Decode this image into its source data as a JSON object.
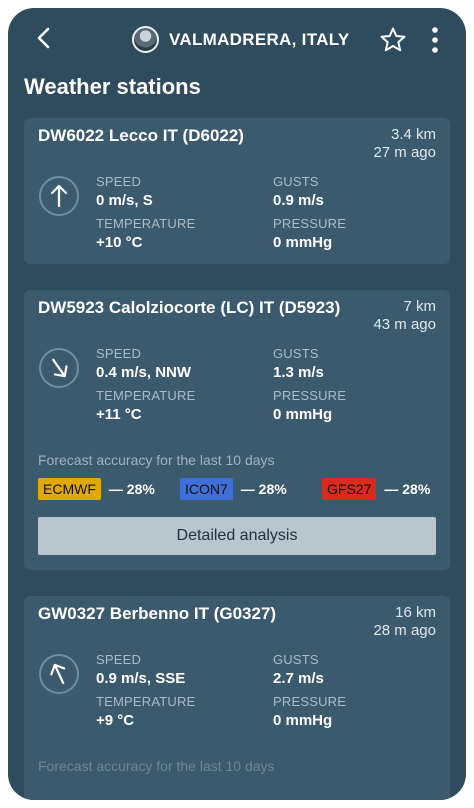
{
  "header": {
    "location": "VALMADRERA, ITALY"
  },
  "page_title": "Weather stations",
  "labels": {
    "speed": "SPEED",
    "gusts": "GUSTS",
    "temperature": "TEMPERATURE",
    "pressure": "PRESSURE",
    "accuracy": "Forecast accuracy for the last 10 days",
    "analysis": "Detailed analysis"
  },
  "stations": [
    {
      "name": "DW6022 Lecco IT (D6022)",
      "distance": "3.4 km",
      "ago": "27 m ago",
      "speed": "0 m/s, S",
      "gusts": "0.9 m/s",
      "temperature": "+10 °C",
      "pressure": "0 mmHg"
    },
    {
      "name": "DW5923 Calolziocorte (LC) IT (D5923)",
      "distance": "7 km",
      "ago": "43 m ago",
      "speed": "0.4 m/s, NNW",
      "gusts": "1.3 m/s",
      "temperature": "+11 °C",
      "pressure": "0 mmHg",
      "models": [
        {
          "name": "ECMWF",
          "pct": "— 28%",
          "color": "#e0a800"
        },
        {
          "name": "ICON7",
          "pct": "— 28%",
          "color": "#3f6fd8"
        },
        {
          "name": "GFS27",
          "pct": "— 28%",
          "color": "#d92a1e"
        }
      ]
    },
    {
      "name": "GW0327 Berbenno IT (G0327)",
      "distance": "16 km",
      "ago": "28 m ago",
      "speed": "0.9 m/s, SSE",
      "gusts": "2.7 m/s",
      "temperature": "+9 °C",
      "pressure": "0 mmHg"
    }
  ]
}
